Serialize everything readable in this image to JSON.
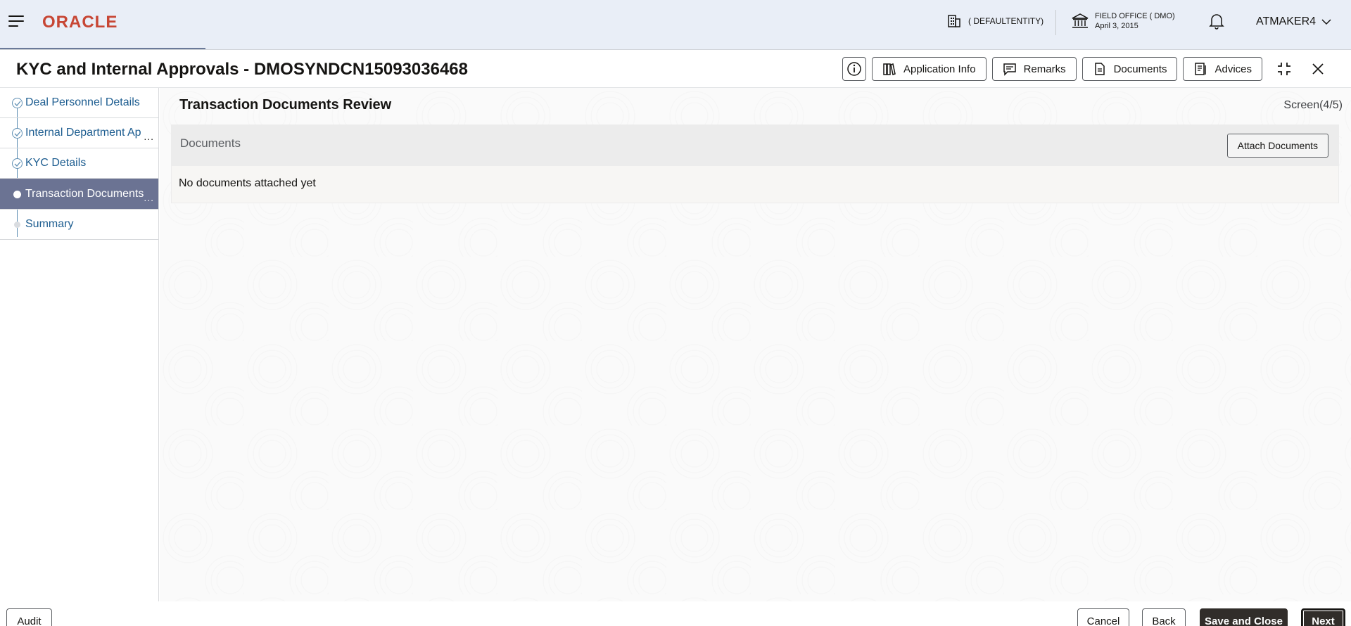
{
  "topbar": {
    "logo": "ORACLE",
    "entity": "( DEFAULTENTITY)",
    "office_name": "FIELD OFFICE ( DMO)",
    "office_date": "April 3, 2015",
    "user": "ATMAKER4"
  },
  "panel": {
    "title": "KYC and Internal Approvals - DMOSYNDCN15093036468",
    "actions": {
      "application_info": "Application Info",
      "remarks": "Remarks",
      "documents": "Documents",
      "advices": "Advices"
    }
  },
  "sidebar": {
    "steps": [
      {
        "label": "Deal Personnel Details",
        "state": "done"
      },
      {
        "label": "Internal Department Ap",
        "state": "done"
      },
      {
        "label": "KYC Details",
        "state": "done"
      },
      {
        "label": "Transaction Documents",
        "state": "active"
      },
      {
        "label": "Summary",
        "state": "pending"
      }
    ],
    "ellipsis": "..."
  },
  "content": {
    "title": "Transaction Documents Review",
    "screen": "Screen(4/5)",
    "documents": {
      "heading": "Documents",
      "attach_label": "Attach Documents",
      "empty_text": "No documents attached yet"
    }
  },
  "footer": {
    "audit": "Audit",
    "cancel": "Cancel",
    "back": "Back",
    "save_close": "Save and Close",
    "next": "Next"
  },
  "colors": {
    "brand": "#c74634",
    "active_step": "#6b7393",
    "link": "#1d5d90",
    "primary_button": "#312d2a"
  }
}
